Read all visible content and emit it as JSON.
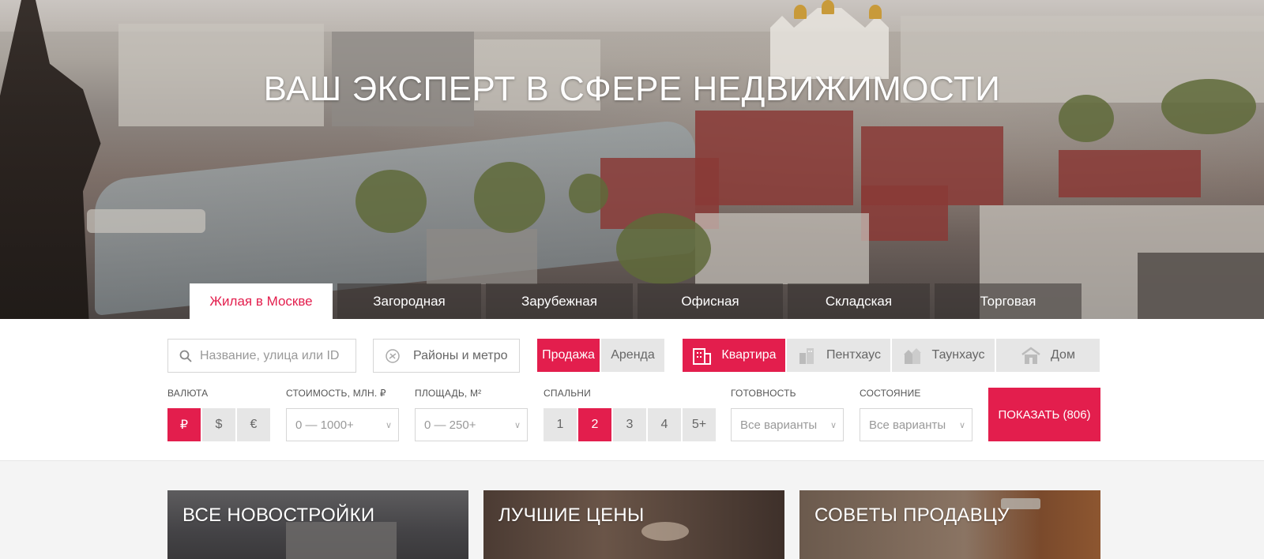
{
  "hero": {
    "title": "ВАШ ЭКСПЕРТ В СФЕРЕ НЕДВИЖИМОСТИ"
  },
  "tabs": [
    {
      "label": "Жилая в Москве",
      "active": true
    },
    {
      "label": "Загородная",
      "active": false
    },
    {
      "label": "Зарубежная",
      "active": false
    },
    {
      "label": "Офисная",
      "active": false
    },
    {
      "label": "Складская",
      "active": false
    },
    {
      "label": "Торговая",
      "active": false
    }
  ],
  "search": {
    "name_placeholder": "Название, улица или ID",
    "districts_label": "Районы и метро"
  },
  "deal": {
    "options": [
      "Продажа",
      "Аренда"
    ],
    "selected": "Продажа"
  },
  "property_types": [
    {
      "label": "Квартира",
      "icon": "apartment-building-icon",
      "selected": true
    },
    {
      "label": "Пентхаус",
      "icon": "penthouse-icon",
      "selected": false
    },
    {
      "label": "Таунхаус",
      "icon": "townhouse-icon",
      "selected": false
    },
    {
      "label": "Дом",
      "icon": "house-icon",
      "selected": false
    }
  ],
  "filters": {
    "currency": {
      "label": "ВАЛЮТА",
      "options": [
        "₽",
        "$",
        "€"
      ],
      "selected": "₽"
    },
    "price": {
      "label": "СТОИМОСТЬ, МЛН. ₽",
      "value": "0 — 1000+"
    },
    "area": {
      "label": "ПЛОЩАДЬ, М²",
      "value": "0 — 250+"
    },
    "bedrooms": {
      "label": "СПАЛЬНИ",
      "options": [
        "1",
        "2",
        "3",
        "4",
        "5+"
      ],
      "selected": "2"
    },
    "readiness": {
      "label": "ГОТОВНОСТЬ",
      "value": "Все варианты"
    },
    "condition": {
      "label": "СОСТОЯНИЕ",
      "value": "Все варианты"
    }
  },
  "show_button": "ПОКАЗАТЬ (806)",
  "cards": [
    {
      "title": "ВСЕ НОВОСТРОЙКИ"
    },
    {
      "title": "ЛУЧШИЕ ЦЕНЫ"
    },
    {
      "title": "СОВЕТЫ ПРОДАВЦУ"
    }
  ],
  "colors": {
    "accent": "#e31e4d",
    "inactive": "#e6e6e6",
    "text_muted": "#999999"
  }
}
